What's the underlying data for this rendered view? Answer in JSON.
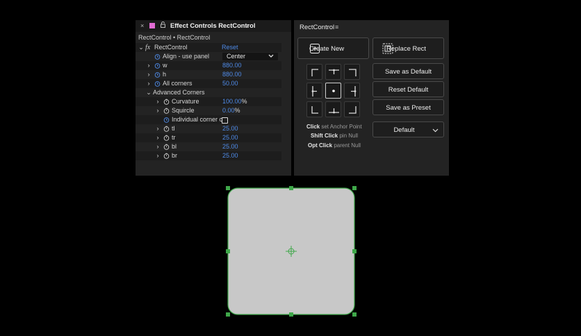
{
  "effect_controls": {
    "close_glyph": "×",
    "label_color": "#e36cd4",
    "title": "Effect Controls RectControl",
    "menu_glyph": "≡",
    "subtitle": "RectControl • RectControl",
    "effect_name": "RectControl",
    "reset_label": "Reset",
    "params": {
      "align_label": "Align - use panel",
      "align_value": "Center",
      "w_label": "w",
      "w_value": "880.00",
      "h_label": "h",
      "h_value": "880.00",
      "all_corners_label": "All corners",
      "all_corners_value": "50.00",
      "advanced_label": "Advanced Corners",
      "curvature_label": "Curvature",
      "curvature_value": "100.00",
      "curvature_unit": "%",
      "squircle_label": "Squircle",
      "squircle_value": "0.00",
      "squircle_unit": "%",
      "individual_label": "Individual corner c",
      "individual_checked": false,
      "tl_label": "tl",
      "tl_value": "25.00",
      "tr_label": "tr",
      "tr_value": "25.00",
      "bl_label": "bl",
      "bl_value": "25.00",
      "br_label": "br",
      "br_value": "25.00"
    }
  },
  "rect_control": {
    "title": "RectControl",
    "menu_glyph": "≡",
    "create_new": "Create New",
    "replace_rect": "Replace Rect",
    "save_default": "Save as Default",
    "reset_default": "Reset Default",
    "save_preset": "Save as Preset",
    "preset_value": "Default",
    "selected_anchor": "center",
    "hints": [
      {
        "key": "Click",
        "text": " set Anchor Point"
      },
      {
        "key": "Shift Click",
        "text": " pin Null"
      },
      {
        "key": "Opt Click",
        "text": " parent Null"
      }
    ]
  },
  "composition": {
    "fill_color": "#c8c8c8",
    "handle_color": "#3fa84a"
  },
  "accent_value_color": "#4f8be8"
}
